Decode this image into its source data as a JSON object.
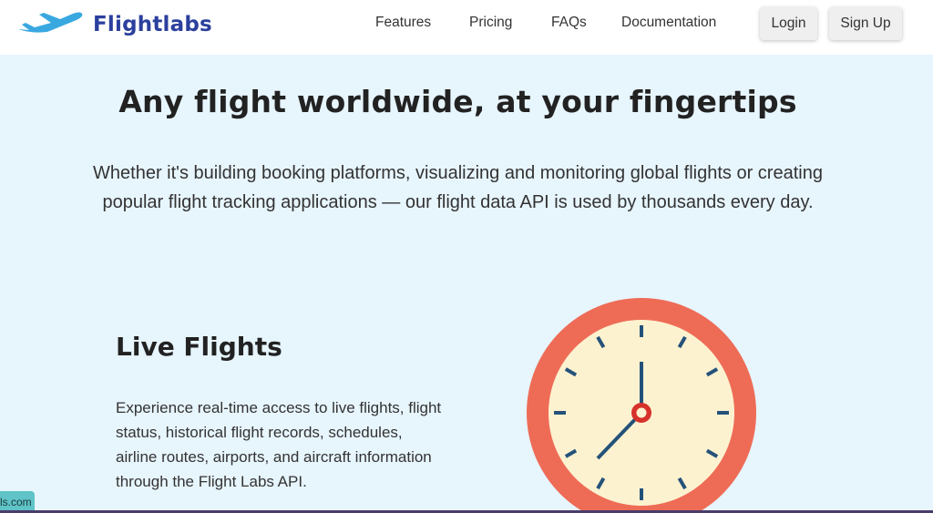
{
  "brand": {
    "name": "Flightlabs"
  },
  "nav": {
    "links": [
      "Features",
      "Pricing",
      "FAQs",
      "Documentation"
    ],
    "login": "Login",
    "signup": "Sign Up"
  },
  "hero": {
    "title": "Any flight worldwide, at your fingertips",
    "subtitle_line1": "Whether it's building booking platforms, visualizing and monitoring global flights or creating",
    "subtitle_line2": "popular flight tracking applications — our flight data API is used by thousands every day."
  },
  "feature": {
    "title": "Live Flights",
    "description": "Experience real-time access to live flights, flight status, historical flight records, schedules, airline routes, airports, and aircraft information through the Flight Labs API."
  },
  "badge": {
    "text": "ls.com"
  },
  "colors": {
    "background": "#e7f5fd",
    "brand": "#2b3f9d",
    "plane": "#3aa8e0",
    "clock_rim": "#ee6c56",
    "clock_face": "#fdf2d0",
    "clock_ticks": "#24527a",
    "clock_center": "#d7312b"
  }
}
